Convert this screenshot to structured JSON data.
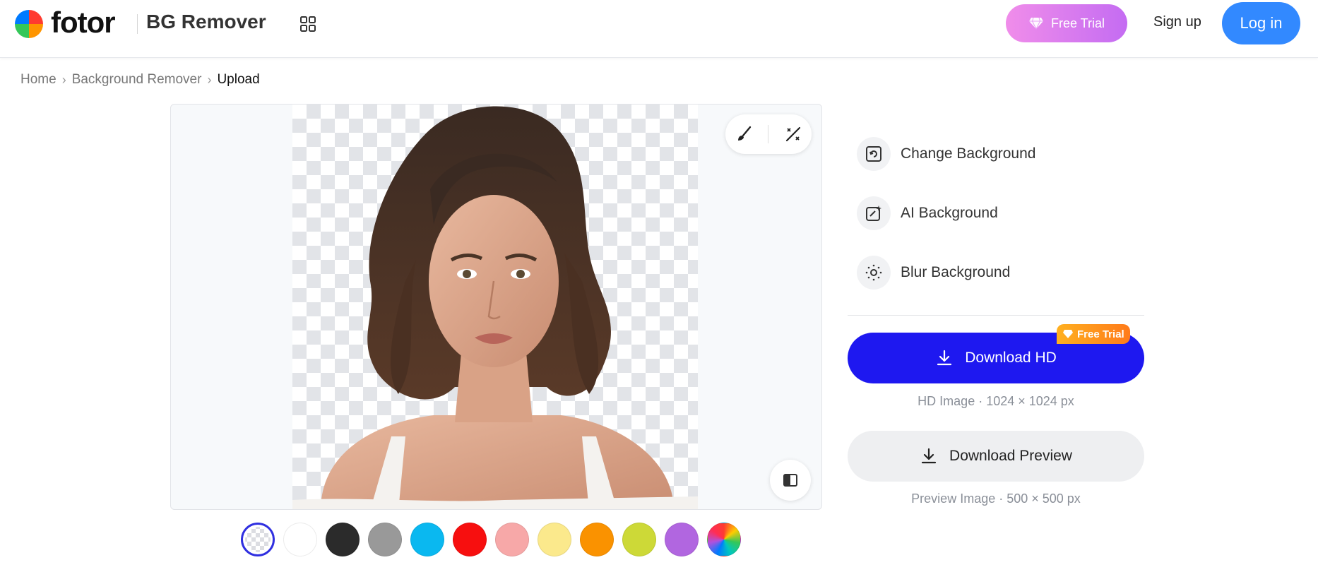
{
  "header": {
    "logo_text": "fotor",
    "product_name": "BG Remover",
    "free_trial_label": "Free Trial",
    "signup_label": "Sign up",
    "login_label": "Log in"
  },
  "breadcrumb": {
    "items": [
      "Home",
      "Background Remover",
      "Upload"
    ],
    "separator": "›"
  },
  "canvas": {
    "tools": [
      "brush-icon",
      "magic-wand-icon"
    ],
    "compare_icon": "compare-icon"
  },
  "swatches": [
    {
      "name": "transparent",
      "selected": true
    },
    {
      "name": "white",
      "color": "#ffffff"
    },
    {
      "name": "black",
      "color": "#2b2b2b"
    },
    {
      "name": "gray",
      "color": "#999999"
    },
    {
      "name": "blue",
      "color": "#0ab8f0"
    },
    {
      "name": "red",
      "color": "#f70f0f"
    },
    {
      "name": "pink",
      "color": "#f7a8a8"
    },
    {
      "name": "yellow",
      "color": "#fbe98c"
    },
    {
      "name": "orange",
      "color": "#fa9200"
    },
    {
      "name": "lime",
      "color": "#cdd937"
    },
    {
      "name": "purple",
      "color": "#b166e0"
    },
    {
      "name": "rainbow"
    }
  ],
  "options": [
    {
      "label": "Change Background",
      "icon": "change-background-icon"
    },
    {
      "label": "AI Background",
      "icon": "ai-background-icon"
    },
    {
      "label": "Blur Background",
      "icon": "blur-background-icon"
    }
  ],
  "download": {
    "hd_label": "Download HD",
    "hd_badge": "Free Trial",
    "hd_caption": "HD Image · 1024 × 1024 px",
    "preview_label": "Download Preview",
    "preview_caption": "Preview Image · 500 × 500 px"
  },
  "colors": {
    "primary_blue": "#1e18f0",
    "login_blue": "#3289ff",
    "trial_gradient_start": "#f08dea",
    "trial_gradient_end": "#c46cf2"
  }
}
